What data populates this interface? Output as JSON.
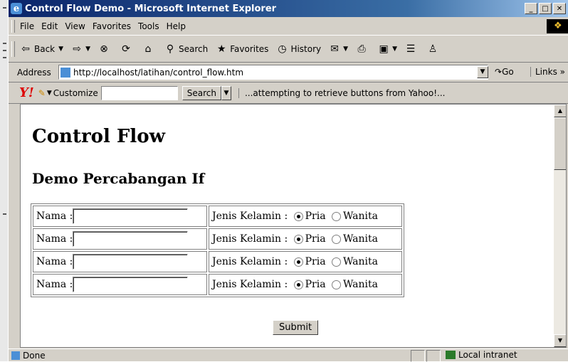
{
  "window": {
    "title": "Control Flow Demo - Microsoft Internet Explorer"
  },
  "menu": [
    "File",
    "Edit",
    "View",
    "Favorites",
    "Tools",
    "Help"
  ],
  "toolbar": {
    "back_label": "Back",
    "search_label": "Search",
    "favorites_label": "Favorites",
    "history_label": "History"
  },
  "address": {
    "label": "Address",
    "url": "http://localhost/latihan/control_flow.htm",
    "go_label": "Go",
    "links_label": "Links"
  },
  "yahoo": {
    "customize_label": "Customize",
    "search_label": "Search",
    "status_text": "...attempting to retrieve buttons from Yahoo!..."
  },
  "page": {
    "title": "Control Flow",
    "subtitle": "Demo Percabangan If",
    "rows": [
      {
        "name_label": "Nama :",
        "gender_label": "Jenis Kelamin :",
        "option_male": "Pria",
        "option_female": "Wanita",
        "selected": "Pria"
      },
      {
        "name_label": "Nama :",
        "gender_label": "Jenis Kelamin :",
        "option_male": "Pria",
        "option_female": "Wanita",
        "selected": "Pria"
      },
      {
        "name_label": "Nama :",
        "gender_label": "Jenis Kelamin :",
        "option_male": "Pria",
        "option_female": "Wanita",
        "selected": "Pria"
      },
      {
        "name_label": "Nama :",
        "gender_label": "Jenis Kelamin :",
        "option_male": "Pria",
        "option_female": "Wanita",
        "selected": "Pria"
      }
    ],
    "submit_label": "Submit"
  },
  "status": {
    "text": "Done",
    "zone": "Local intranet"
  }
}
